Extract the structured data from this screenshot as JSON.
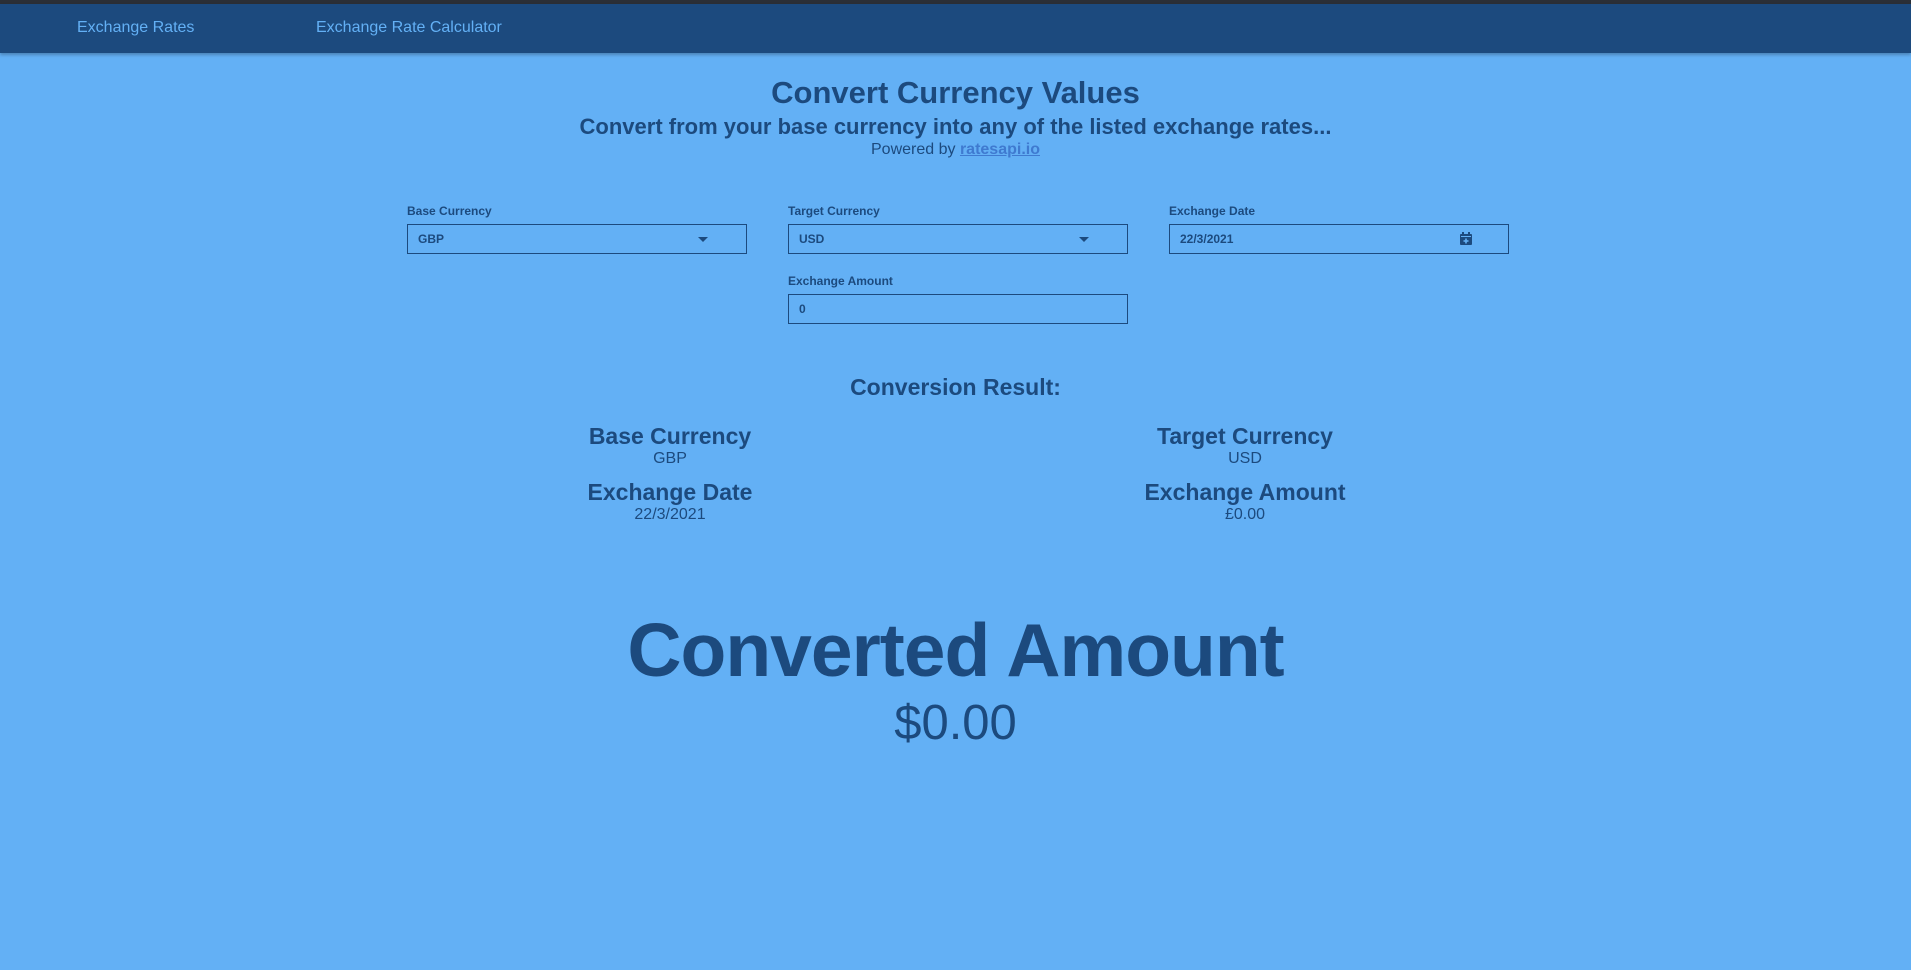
{
  "nav": {
    "items": [
      {
        "label": "Exchange Rates"
      },
      {
        "label": "Exchange Rate Calculator"
      }
    ]
  },
  "header": {
    "title": "Convert Currency Values",
    "subtitle": "Convert from your base currency into any of the listed exchange rates...",
    "powered_prefix": "Powered by",
    "powered_link": "ratesapi.io"
  },
  "form": {
    "base_currency": {
      "label": "Base Currency",
      "value": "GBP"
    },
    "target_currency": {
      "label": "Target Currency",
      "value": "USD"
    },
    "exchange_date": {
      "label": "Exchange Date",
      "value": "22/3/2021"
    },
    "exchange_amount": {
      "label": "Exchange Amount",
      "value": "0"
    }
  },
  "result": {
    "title": "Conversion Result:",
    "base_currency": {
      "label": "Base Currency",
      "value": "GBP"
    },
    "target_currency": {
      "label": "Target Currency",
      "value": "USD"
    },
    "exchange_date": {
      "label": "Exchange Date",
      "value": "22/3/2021"
    },
    "exchange_amount": {
      "label": "Exchange Amount",
      "value": "£0.00"
    }
  },
  "converted": {
    "title": "Converted Amount",
    "value": "$0.00"
  },
  "colors": {
    "background": "#63b0f5",
    "navbar": "#1c4a7e",
    "text": "#1c4a7e",
    "link": "#3f7ad0"
  },
  "icons": {
    "dropdown": "caret-down-icon",
    "date": "calendar-icon"
  }
}
